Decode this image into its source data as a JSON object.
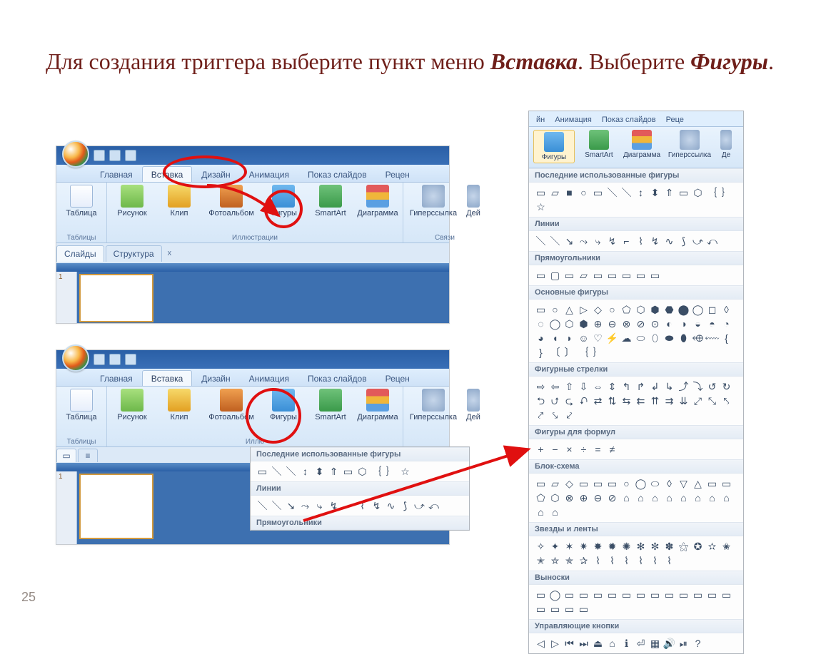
{
  "page_number": "25",
  "heading": {
    "part1": "Для создания триггера выберите пункт меню ",
    "insert": "Вставка",
    "part2": ". Выберите ",
    "shapes": "Фигуры",
    "part3": "."
  },
  "tabs": {
    "home": "Главная",
    "insert": "Вставка",
    "design": "Дизайн",
    "anim": "Анимация",
    "slideshow": "Показ слайдов",
    "review": "Рецен"
  },
  "ribbon": {
    "table": "Таблица",
    "picture": "Рисунок",
    "clip": "Клип",
    "album": "Фотоальбом",
    "shapes": "Фигуры",
    "smartart": "SmartArt",
    "chart": "Диаграмма",
    "hyperlink": "Гиперссылка",
    "action": "Дей",
    "group_tables": "Таблицы",
    "group_illustrations": "Иллюстрации",
    "group_illustrations_short": "Иллю",
    "group_links": "Связи"
  },
  "pane": {
    "slides": "Слайды",
    "outline": "Структура",
    "close": "x",
    "one": "1"
  },
  "gallery": {
    "tabs": {
      "ani": "Анимация",
      "slideshow": "Показ слайдов",
      "review": "Реце",
      "jn": "йн"
    },
    "btns": {
      "shapes": "Фигуры",
      "smartart": "SmartArt",
      "chart": "Диаграмма",
      "hyper": "Гиперссылка",
      "act": "Де"
    },
    "recent": "Последние использованные фигуры",
    "lines": "Линии",
    "rects": "Прямоугольники",
    "basic": "Основные фигуры",
    "block_arrows": "Фигурные стрелки",
    "equation": "Фигуры для формул",
    "flowchart": "Блок-схема",
    "stars": "Звезды и ленты",
    "callouts": "Выноски",
    "action_buttons": "Управляющие кнопки"
  },
  "glyphs": {
    "recent": [
      "▭",
      "▱",
      "■",
      "○",
      "▭",
      "＼",
      "＼",
      "↕",
      "⬍",
      "⇑",
      "▭",
      "⬡",
      "｛",
      "｝",
      "☆"
    ],
    "recent_small": [
      "▭",
      "＼",
      "＼",
      "↕",
      "⬍",
      "⇑",
      "▭",
      "⬡",
      "｛",
      "｝",
      "☆"
    ],
    "lines": [
      "＼",
      "＼",
      "↘",
      "⤳",
      "⤷",
      "↯",
      "⌐",
      "⌇",
      "↯",
      "∿",
      "⟆",
      "⤻",
      "⤺"
    ],
    "lines_small": [
      "＼",
      "＼",
      "↘",
      "⤳",
      "⤷",
      "↯",
      "⌐",
      "⌇",
      "↯",
      "∿",
      "⟆",
      "⤻",
      "⤺"
    ],
    "rects": [
      "▭",
      "▢",
      "▭",
      "▱",
      "▭",
      "▭",
      "▭",
      "▭",
      "▭"
    ],
    "basic": [
      "▭",
      "○",
      "△",
      "▷",
      "◇",
      "○",
      "⬠",
      "⬡",
      "⬢",
      "⬣",
      "⬤",
      "◯",
      "◻",
      "◊",
      "◌",
      "◯",
      "⬡",
      "⬢",
      "⊕",
      "⊖",
      "⊗",
      "⊘",
      "⊙",
      "◐",
      "◑",
      "◒",
      "◓",
      "◔",
      "◕",
      "◖",
      "◗",
      "☺",
      "♡",
      "⚡",
      "☁",
      "⬭",
      "⬯",
      "⬬",
      "⬮",
      "⬲",
      "⬳",
      "{",
      "}",
      "〔",
      "〕",
      "｛",
      "｝"
    ],
    "block_arrows": [
      "⇨",
      "⇦",
      "⇧",
      "⇩",
      "⇔",
      "⇕",
      "↰",
      "↱",
      "↲",
      "↳",
      "⤴",
      "⤵",
      "↺",
      "↻",
      "⮌",
      "⮍",
      "⮎",
      "⮏",
      "⇄",
      "⇅",
      "⇆",
      "⇇",
      "⇈",
      "⇉",
      "⇊",
      "⤢",
      "⤡",
      "⤣",
      "⤤",
      "⤥",
      "⤦"
    ],
    "equation": [
      "+",
      "−",
      "×",
      "÷",
      "=",
      "≠"
    ],
    "flowchart": [
      "▭",
      "▱",
      "◇",
      "▭",
      "▭",
      "▭",
      "○",
      "◯",
      "⬭",
      "◊",
      "▽",
      "△",
      "▭",
      "▭",
      "⬠",
      "⬡",
      "⊗",
      "⊕",
      "⊖",
      "⊘",
      "⌂",
      "⌂",
      "⌂",
      "⌂",
      "⌂",
      "⌂",
      "⌂",
      "⌂",
      "⌂",
      "⌂"
    ],
    "stars": [
      "✧",
      "✦",
      "✶",
      "✷",
      "✸",
      "✹",
      "✺",
      "✻",
      "✼",
      "✽",
      "⚝",
      "✪",
      "✫",
      "✬",
      "✭",
      "✮",
      "✯",
      "✰",
      "⌇",
      "⌇",
      "⌇",
      "⌇",
      "⌇",
      "⌇"
    ],
    "callouts": [
      "▭",
      "◯",
      "▭",
      "▭",
      "▭",
      "▭",
      "▭",
      "▭",
      "▭",
      "▭",
      "▭",
      "▭",
      "▭",
      "▭",
      "▭",
      "▭",
      "▭",
      "▭"
    ],
    "action_buttons": [
      "◁",
      "▷",
      "⏮",
      "⏭",
      "⏏",
      "⌂",
      "ℹ",
      "⏎",
      "▦",
      "🔊",
      "⏯",
      "?"
    ]
  }
}
